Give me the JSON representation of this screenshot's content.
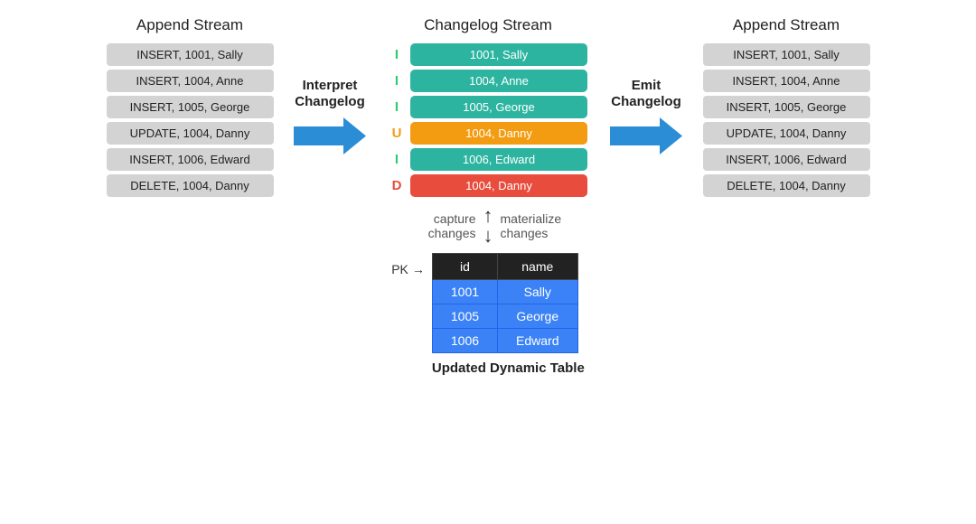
{
  "left_stream": {
    "title": "Append Stream",
    "items": [
      "INSERT, 1001, Sally",
      "INSERT, 1004, Anne",
      "INSERT, 1005, George",
      "UPDATE, 1004, Danny",
      "INSERT, 1006, Edward",
      "DELETE, 1004, Danny"
    ]
  },
  "changelog_stream": {
    "title": "Changelog Stream",
    "items": [
      {
        "letter": "I",
        "type": "insert",
        "text": "1001, Sally"
      },
      {
        "letter": "I",
        "type": "insert",
        "text": "1004, Anne"
      },
      {
        "letter": "I",
        "type": "insert",
        "text": "1005, George"
      },
      {
        "letter": "U",
        "type": "update",
        "text": "1004, Danny"
      },
      {
        "letter": "I",
        "type": "insert",
        "text": "1006, Edward"
      },
      {
        "letter": "D",
        "type": "delete",
        "text": "1004, Danny"
      }
    ]
  },
  "right_stream": {
    "title": "Append Stream",
    "items": [
      "INSERT, 1001, Sally",
      "INSERT, 1004, Anne",
      "INSERT, 1005, George",
      "UPDATE, 1004, Danny",
      "INSERT, 1006, Edward",
      "DELETE, 1004, Danny"
    ]
  },
  "left_arrow": {
    "label": "Interpret\nChangelog"
  },
  "right_arrow": {
    "label": "Emit\nChangelog"
  },
  "bottom": {
    "capture_label": "capture\nchanges",
    "materialize_label": "materialize\nchanges",
    "pk_label": "PK",
    "table_headers": [
      "id",
      "name"
    ],
    "table_rows": [
      [
        "1001",
        "Sally"
      ],
      [
        "1005",
        "George"
      ],
      [
        "1006",
        "Edward"
      ]
    ],
    "table_caption": "Updated Dynamic Table"
  }
}
